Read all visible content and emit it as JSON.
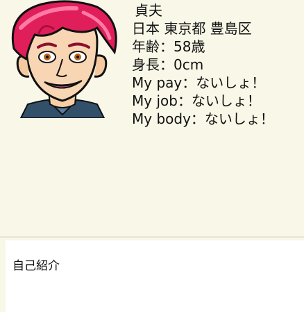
{
  "profile": {
    "name": "貞夫",
    "location": "日本 東京都 豊島区",
    "age": "年齢：58歳",
    "height": "身長：0cm",
    "pay": "My pay：ないしょ！",
    "job": "My job：ないしょ！",
    "body": "My body：ないしょ！",
    "avatar_icon": "cartoon-man-red-hair-avatar"
  },
  "self_intro": {
    "label": "自己紹介"
  },
  "colors": {
    "background": "#f9f8e8",
    "hair": "#e01e5a",
    "panel": "#ffffff"
  }
}
